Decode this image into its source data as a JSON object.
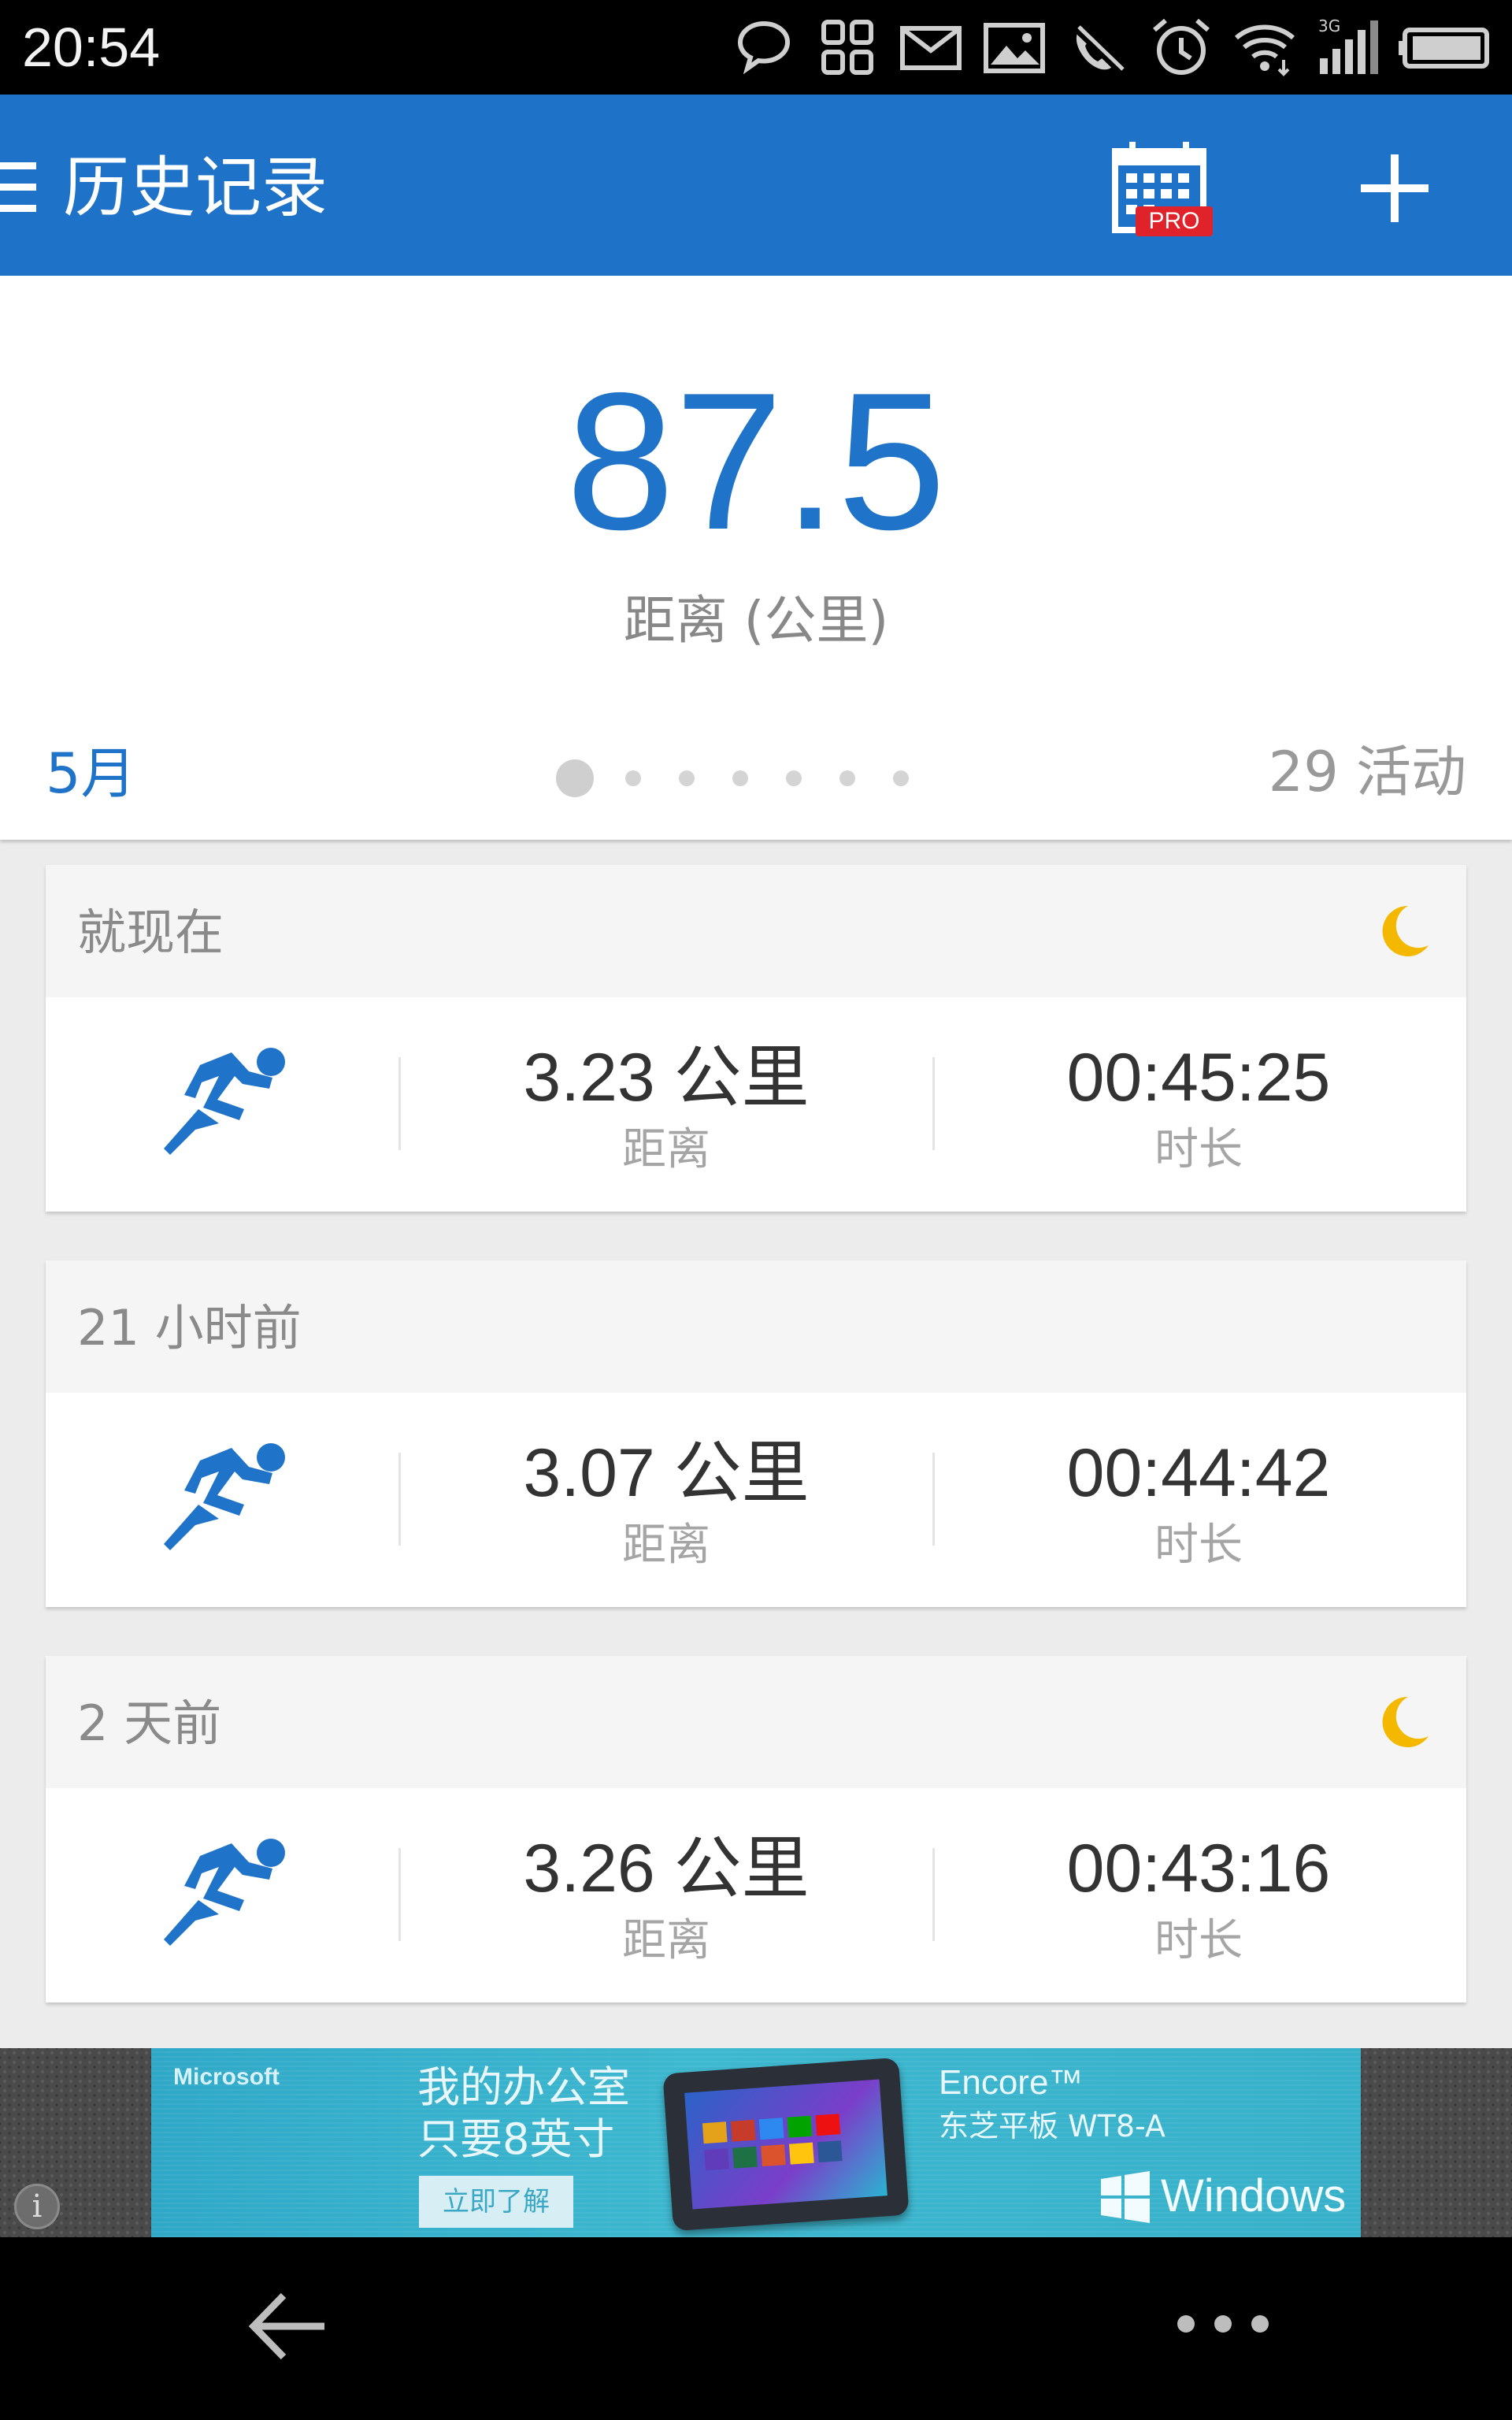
{
  "status_bar": {
    "time": "20:54",
    "icons": [
      "chat-icon",
      "qr-icon",
      "mail-icon",
      "image-icon",
      "phone-off-icon",
      "alarm-icon",
      "wifi-icon",
      "signal-3g-icon",
      "battery-icon"
    ],
    "signal_label": "3G"
  },
  "app_bar": {
    "title": "历史记录",
    "pro_badge": "PRO",
    "background": "#1e73c8"
  },
  "summary": {
    "total": "87.5",
    "total_label": "距离 (公里)",
    "month": "5月",
    "activity_count": "29 活动",
    "page_count": 7,
    "active_page": 1
  },
  "activities": [
    {
      "when": "就现在",
      "night": true,
      "distance": "3.23 公里",
      "distance_label": "距离",
      "duration": "00:45:25",
      "duration_label": "时长"
    },
    {
      "when": "21 小时前",
      "night": false,
      "distance": "3.07 公里",
      "distance_label": "距离",
      "duration": "00:44:42",
      "duration_label": "时长"
    },
    {
      "when": "2 天前",
      "night": true,
      "distance": "3.26 公里",
      "distance_label": "距离",
      "duration": "00:43:16",
      "duration_label": "时长"
    }
  ],
  "ad": {
    "brand": "Microsoft",
    "headline_line1": "我的办公室",
    "headline_line2": "只要8英寸",
    "cta": "立即了解",
    "product_line1": "Encore™",
    "product_line2": "东芝平板 WT8-A",
    "windows": "Windows"
  },
  "colors": {
    "accent": "#1f73c9",
    "moon": "#f5b800"
  }
}
